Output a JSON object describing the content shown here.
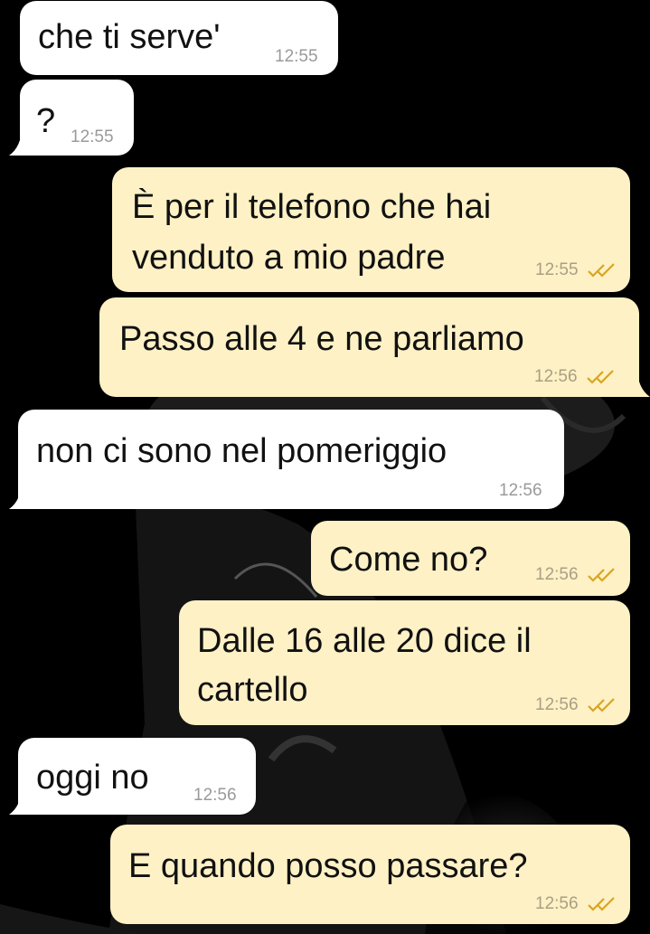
{
  "chat": {
    "messages": [
      {
        "direction": "in",
        "text": "che ti serve'",
        "time": "12:55"
      },
      {
        "direction": "in",
        "text": "?",
        "time": "12:55"
      },
      {
        "direction": "out",
        "text_lines": [
          "È per il telefono che hai",
          "venduto a mio padre"
        ],
        "time": "12:55",
        "status": "read-double-check"
      },
      {
        "direction": "out",
        "text": "Passo alle 4 e ne parliamo",
        "time": "12:56",
        "status": "read-double-check"
      },
      {
        "direction": "in",
        "text": "non ci sono nel pomeriggio",
        "time": "12:56"
      },
      {
        "direction": "out",
        "text": "Come no?",
        "time": "12:56",
        "status": "read-double-check"
      },
      {
        "direction": "out",
        "text_lines": [
          "Dalle 16 alle 20 dice il",
          "cartello"
        ],
        "time": "12:56",
        "status": "read-double-check"
      },
      {
        "direction": "in",
        "text": "oggi no",
        "time": "12:56"
      },
      {
        "direction": "out",
        "text": "E quando posso passare?",
        "time": "12:56",
        "status": "read-double-check"
      }
    ]
  },
  "colors": {
    "background": "#000000",
    "incoming_bubble": "#ffffff",
    "outgoing_bubble": "#fdf1c5",
    "tick_color": "#d9a520"
  }
}
